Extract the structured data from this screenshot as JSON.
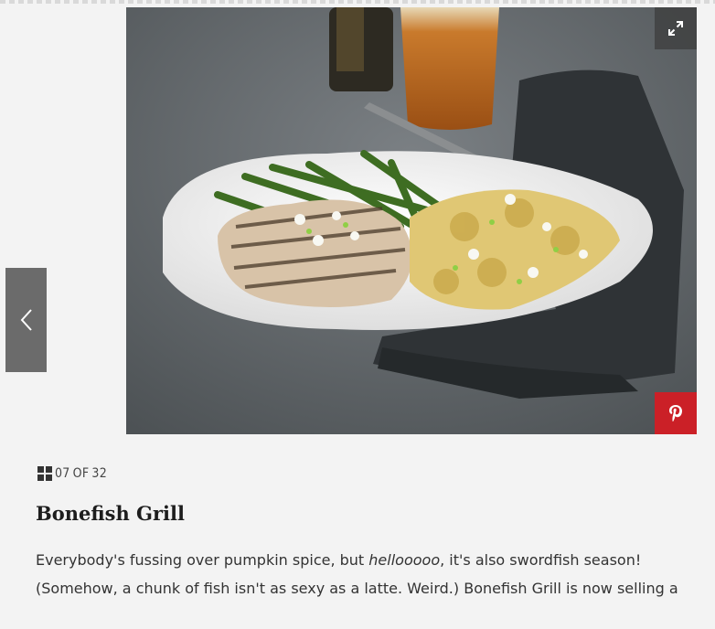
{
  "gallery": {
    "counter": {
      "current": "07",
      "separator": "OF",
      "total": "32"
    },
    "slide": {
      "title": "Bonefish Grill",
      "description": {
        "line1_before": "Everybody's fussing over pumpkin spice, but ",
        "line1_emphasis": "hellooooo",
        "line1_after": ", it's also swordfish season!",
        "line2": "(Somehow, a chunk of fish isn't as sexy as a latte. Weird.) Bonefish Grill is now selling a"
      }
    },
    "icons": {
      "expand": "expand-arrows-icon",
      "pinterest": "pinterest-icon",
      "previous": "chevron-left-icon",
      "gallery": "grid-icon"
    },
    "colors": {
      "pinterest": "#cb2027",
      "nav_button": "#6b6b6b"
    }
  }
}
